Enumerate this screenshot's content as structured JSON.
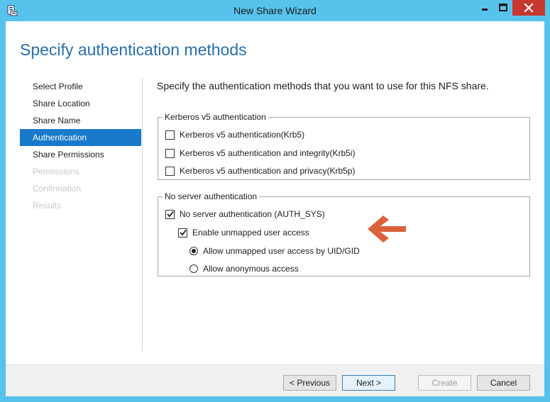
{
  "window": {
    "title": "New Share Wizard",
    "accent_color": "#57c3ec",
    "close_color": "#c7372f"
  },
  "page": {
    "title": "Specify authentication methods",
    "instruction": "Specify the authentication methods that you want to use for this NFS share."
  },
  "nav": {
    "items": [
      {
        "label": "Select Profile",
        "state": "normal"
      },
      {
        "label": "Share Location",
        "state": "normal"
      },
      {
        "label": "Share Name",
        "state": "normal"
      },
      {
        "label": "Authentication",
        "state": "active"
      },
      {
        "label": "Share Permissions",
        "state": "normal"
      },
      {
        "label": "Permissions",
        "state": "disabled"
      },
      {
        "label": "Confirmation",
        "state": "disabled"
      },
      {
        "label": "Results",
        "state": "disabled"
      }
    ]
  },
  "kerberos": {
    "legend": "Kerberos v5 authentication",
    "options": [
      {
        "label": "Kerberos v5 authentication(Krb5)",
        "checked": false
      },
      {
        "label": "Kerberos v5 authentication and integrity(Krb5i)",
        "checked": false
      },
      {
        "label": "Kerberos v5 authentication and privacy(Krb5p)",
        "checked": false
      }
    ]
  },
  "no_server_auth": {
    "legend": "No server authentication",
    "auth_sys": {
      "label": "No server authentication (AUTH_SYS)",
      "checked": true
    },
    "unmapped": {
      "label": "Enable unmapped user access",
      "checked": true
    },
    "radios": [
      {
        "label": "Allow unmapped user access by UID/GID",
        "selected": true
      },
      {
        "label": "Allow anonymous access",
        "selected": false
      }
    ]
  },
  "annotation": {
    "arrow_color": "#d9623b",
    "direction": "left"
  },
  "footer": {
    "previous_label": "< Previous",
    "next_label": "Next >",
    "create_label": "Create",
    "cancel_label": "Cancel"
  }
}
